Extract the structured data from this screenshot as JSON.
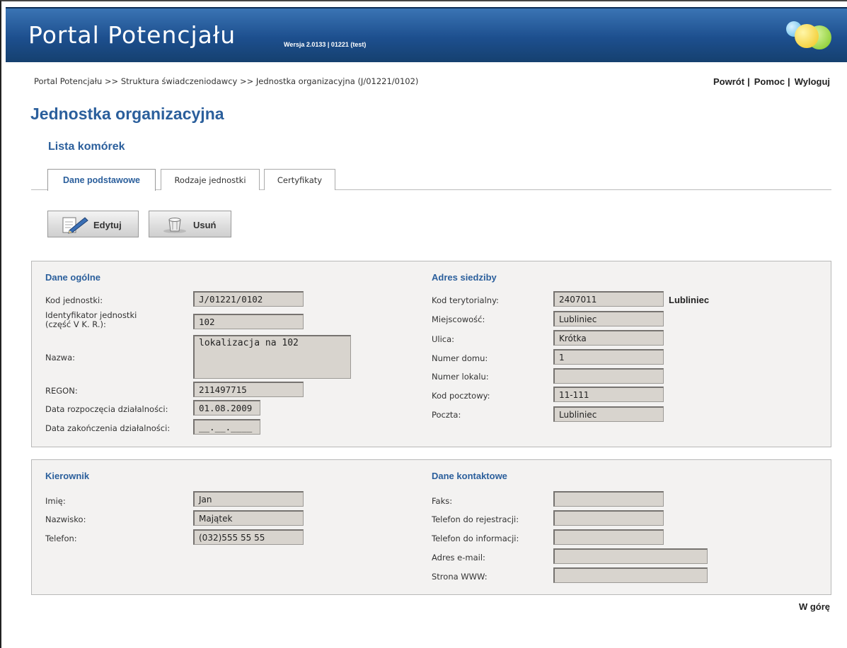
{
  "header": {
    "title": "Portal Potencjału",
    "version": "Wersja 2.0133 | 01221 (test)"
  },
  "breadcrumb": "Portal Potencjału >> Struktura świadczeniodawcy >> Jednostka organizacyjna (J/01221/0102)",
  "top_links": {
    "back": "Powrót",
    "help": "Pomoc",
    "logout": "Wyloguj",
    "separator": "|"
  },
  "page_title": "Jednostka organizacyjna",
  "subtitle": "Lista komórek",
  "tabs": [
    {
      "label": "Dane podstawowe",
      "active": true
    },
    {
      "label": "Rodzaje jednostki",
      "active": false
    },
    {
      "label": "Certyfikaty",
      "active": false
    }
  ],
  "buttons": {
    "edit": "Edytuj",
    "delete": "Usuń"
  },
  "general": {
    "title": "Dane ogólne",
    "code_label": "Kod jednostki:",
    "code": "J/01221/0102",
    "id_label_1": "Identyfikator jednostki",
    "id_label_2": "(część V K. R.):",
    "id": "102",
    "name_label": "Nazwa:",
    "name": "lokalizacja na 102",
    "regon_label": "REGON:",
    "regon": "211497715",
    "start_label": "Data rozpoczęcia działalności:",
    "start": "01.08.2009",
    "end_label": "Data zakończenia działalności:",
    "end": "__.__.____"
  },
  "address": {
    "title": "Adres siedziby",
    "terr_label": "Kod terytorialny:",
    "terr": "2407011",
    "terr_name": "Lubliniec",
    "city_label": "Miejscowość:",
    "city": "Lubliniec",
    "street_label": "Ulica:",
    "street": "Krótka",
    "house_label": "Numer domu:",
    "house": "1",
    "flat_label": "Numer lokalu:",
    "flat": "",
    "postal_label": "Kod pocztowy:",
    "postal": "11-111",
    "post_label": "Poczta:",
    "post": "Lubliniec"
  },
  "manager": {
    "title": "Kierownik",
    "first_label": "Imię:",
    "first": "Jan",
    "last_label": "Nazwisko:",
    "last": "Majątek",
    "phone_label": "Telefon:",
    "phone": "(032)555 55 55"
  },
  "contact": {
    "title": "Dane kontaktowe",
    "fax_label": "Faks:",
    "fax": "",
    "reg_phone_label": "Telefon do rejestracji:",
    "reg_phone": "",
    "info_phone_label": "Telefon do informacji:",
    "info_phone": "",
    "email_label": "Adres e-mail:",
    "email": "",
    "www_label": "Strona WWW:",
    "www": ""
  },
  "footer": {
    "top_link": "W górę"
  },
  "colors": {
    "header_blue": "#1d4f8e",
    "title_blue": "#2b5f9c",
    "field_bg": "#d8d4ce",
    "panel_bg": "#f3f2f1"
  },
  "icons": {
    "logo": "three-bubbles-logo",
    "edit": "pencil-document-icon",
    "delete": "trash-bin-icon"
  }
}
